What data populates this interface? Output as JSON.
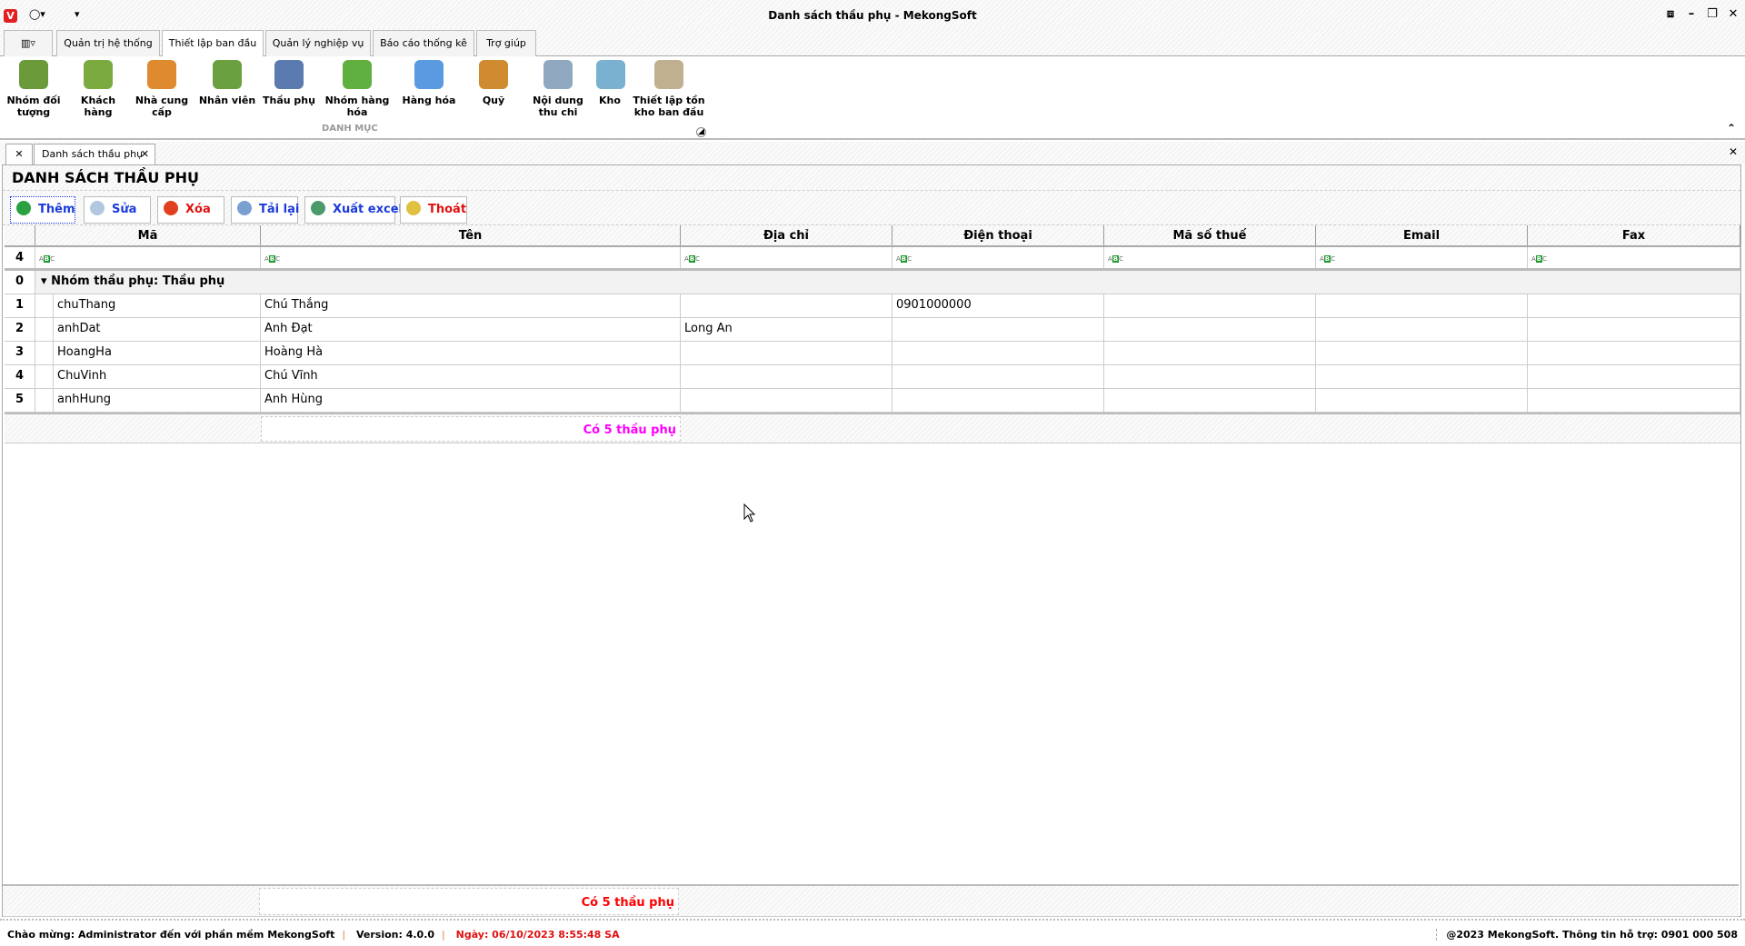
{
  "window": {
    "title": "Danh sách thầu phụ - MekongSoft",
    "app_icon": "V"
  },
  "ribbon_tabs": [
    "Quản trị hệ thống",
    "Thiết lập ban đầu",
    "Quản lý nghiệp vụ",
    "Báo cáo thống kê",
    "Trợ giúp"
  ],
  "active_tab": "Thiết lập ban đầu",
  "ribbon_items": [
    {
      "label": "Nhóm đối tượng",
      "icon": "people-group-icon",
      "color": "#6a9a3a"
    },
    {
      "label": "Khách hàng",
      "icon": "customer-icon",
      "color": "#7aaa40"
    },
    {
      "label": "Nhà cung cấp",
      "icon": "supplier-icon",
      "color": "#e08a30"
    },
    {
      "label": "Nhân viên",
      "icon": "employee-icon",
      "color": "#6aa040"
    },
    {
      "label": "Thầu phụ",
      "icon": "worker-icon",
      "color": "#5a7ab0"
    },
    {
      "label": "Nhóm hàng hóa",
      "icon": "product-group-icon",
      "color": "#60b040"
    },
    {
      "label": "Hàng hóa",
      "icon": "star-icon",
      "color": "#5a9ae0"
    },
    {
      "label": "Quỹ",
      "icon": "coins-icon",
      "color": "#d08a30"
    },
    {
      "label": "Nội dung thu chi",
      "icon": "document-add-icon",
      "color": "#90a8c0"
    },
    {
      "label": "Kho",
      "icon": "warehouse-icon",
      "color": "#7ab0d0"
    },
    {
      "label": "Thiết lập tồn kho ban đầu",
      "icon": "columns-icon",
      "color": "#c0b090"
    }
  ],
  "ribbon_group": "DANH MỤC",
  "doc_tab": "Danh sách thầu phụ",
  "panel_title": "DANH SÁCH THẦU PHỤ",
  "toolbar": [
    {
      "label": "Thêm",
      "icon": "add-icon",
      "color": "#1a3adb",
      "icolor": "#2aa040"
    },
    {
      "label": "Sửa",
      "icon": "edit-icon",
      "color": "#1a3adb",
      "icolor": "#b0c8e0"
    },
    {
      "label": "Xóa",
      "icon": "delete-icon",
      "color": "#e01010",
      "icolor": "#e04020"
    },
    {
      "label": "Tải lại",
      "icon": "refresh-icon",
      "color": "#1a3adb",
      "icolor": "#7aa0d0"
    },
    {
      "label": "Xuất excel",
      "icon": "excel-icon",
      "color": "#1a3adb",
      "icolor": "#4a9a6a"
    },
    {
      "label": "Thoát",
      "icon": "exit-icon",
      "color": "#e01010",
      "icolor": "#e0c040"
    }
  ],
  "columns": [
    "Mã",
    "Tên",
    "Địa chỉ",
    "Điện thoại",
    "Mã số thuế",
    "Email",
    "Fax"
  ],
  "filter_row_index": "4",
  "group": {
    "index": "0",
    "label": "Nhóm thầu phụ: Thầu phụ"
  },
  "rows": [
    {
      "n": "1",
      "cells": [
        "chuThang",
        "Chú Thắng",
        "",
        "0901000000",
        "",
        "",
        ""
      ]
    },
    {
      "n": "2",
      "cells": [
        "anhDat",
        "Anh Đạt",
        "Long An",
        "",
        "",
        "",
        ""
      ]
    },
    {
      "n": "3",
      "cells": [
        "HoangHa",
        "Hoàng Hà",
        "",
        "",
        "",
        "",
        ""
      ]
    },
    {
      "n": "4",
      "cells": [
        "ChuVinh",
        "Chú Vĩnh",
        "",
        "",
        "",
        "",
        ""
      ]
    },
    {
      "n": "5",
      "cells": [
        "anhHung",
        "Anh Hùng",
        "",
        "",
        "",
        "",
        ""
      ]
    }
  ],
  "group_summary": "Có 5 thầu phụ",
  "total_summary": "Có 5 thầu phụ",
  "status": {
    "welcome": "Chào mừng: Administrator đến với phần mềm MekongSoft",
    "version": "Version: 4.0.0",
    "date": "Ngày: 06/10/2023 8:55:48 SA",
    "copyright": "@2023 MekongSoft. Thông tin hỗ trợ: 0901 000 508"
  }
}
